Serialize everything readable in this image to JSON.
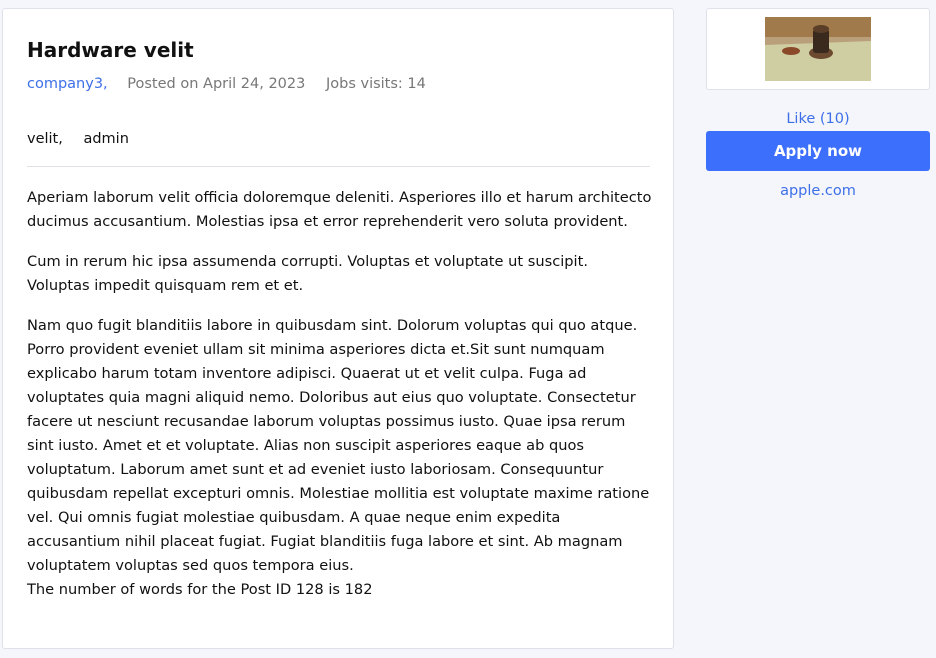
{
  "job": {
    "title": "Hardware velit",
    "company": "company3,",
    "posted": "Posted on April 24, 2023",
    "visits": "Jobs visits: 14",
    "tags": [
      "velit,",
      "admin"
    ],
    "paragraphs": [
      "Aperiam laborum velit officia doloremque deleniti. Asperiores illo et harum architecto ducimus accusantium. Molestias ipsa et error reprehenderit vero soluta provident.",
      "Cum in rerum hic ipsa assumenda corrupti. Voluptas et voluptate ut suscipit. Voluptas impedit quisquam rem et et.",
      "Nam quo fugit blanditiis labore in quibusdam sint. Dolorum voluptas qui quo atque. Porro provident eveniet ullam sit minima asperiores dicta et.Sit sunt numquam explicabo harum totam inventore adipisci. Quaerat ut et velit culpa. Fuga ad voluptates quia magni aliquid nemo. Doloribus aut eius quo voluptate. Consectetur facere ut nesciunt recusandae laborum voluptas possimus iusto. Quae ipsa rerum sint iusto. Amet et et voluptate. Alias non suscipit asperiores eaque ab quos voluptatum. Laborum amet sunt et ad eveniet iusto laboriosam. Consequuntur quibusdam repellat excepturi omnis. Molestiae mollitia est voluptate maxime ratione vel. Qui omnis fugiat molestiae quibusdam. A quae neque enim expedita accusantium nihil placeat fugiat. Fugiat blanditiis fuga labore et sint. Ab magnam voluptatem voluptas sed quos tempora eius."
    ],
    "word_count": "The number of words for the Post ID 128 is 182"
  },
  "sidebar": {
    "like": "Like (10)",
    "apply": "Apply now",
    "website": "apple.com"
  },
  "colors": {
    "accent": "#3d6fe8",
    "button": "#3d6ffd"
  }
}
